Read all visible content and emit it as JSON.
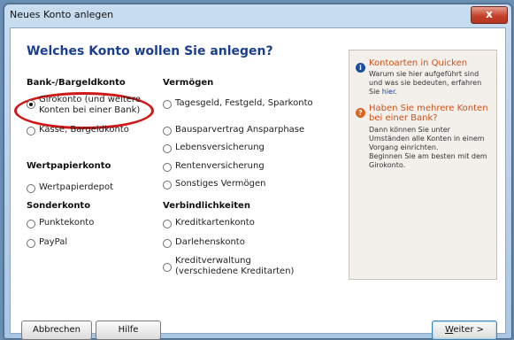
{
  "window": {
    "title": "Neues Konto anlegen",
    "close_label": "x"
  },
  "heading": "Welches Konto wollen Sie anlegen?",
  "sections": {
    "bank": "Bank-/Bargeldkonto",
    "vermoegen": "Vermögen",
    "wertpapier": "Wertpapierkonto",
    "sonder": "Sonderkonto",
    "verbindlichkeiten": "Verbindlichkeiten"
  },
  "options": {
    "giro_line1": "Girokonto (und weitere",
    "giro_line2": "Konten bei einer Bank)",
    "kasse": "Kasse, Bargeldkonto",
    "tagesgeld": "Tagesgeld, Festgeld, Sparkonto",
    "bauspar": "Bausparvertrag Ansparphase",
    "lebens": "Lebensversicherung",
    "renten": "Rentenversicherung",
    "sonstiges": "Sonstiges Vermögen",
    "depot": "Wertpapierdepot",
    "punkte": "Punktekonto",
    "paypal": "PayPal",
    "kreditkarte": "Kreditkartenkonto",
    "darlehen": "Darlehenskonto",
    "kredit_line1": "Kreditverwaltung",
    "kredit_line2": "(verschiedene Kreditarten)"
  },
  "selected_option": "Girokonto (und weitere Konten bei einer Bank)",
  "info": {
    "title1": "Kontoarten in Quicken",
    "text1_l1": "Warum sie hier aufgeführt sind",
    "text1_l2": "und was sie bedeuten, erfahren",
    "text1_l3_pre": "Sie ",
    "text1_link": "hier",
    "text1_l3_post": ".",
    "title2_l1": "Haben Sie mehrere Konten",
    "title2_l2": "bei einer Bank?",
    "text2_l1": "Dann können Sie unter",
    "text2_l2": "Umständen alle Konten in einem",
    "text2_l3": "Vorgang einrichten.",
    "text2_l4": "Beginnen Sie am besten mit dem",
    "text2_l5": "Girokonto."
  },
  "buttons": {
    "cancel": "Abbrechen",
    "help": "Hilfe",
    "next_underlined": "W",
    "next_rest": "eiter >"
  },
  "colors": {
    "heading": "#1b3f8f",
    "highlight": "#d01616",
    "info_title": "#c9531b"
  }
}
